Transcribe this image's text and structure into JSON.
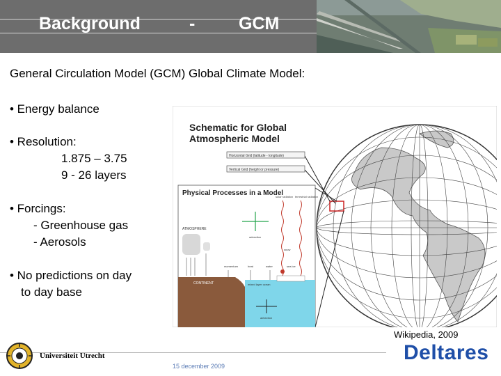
{
  "header": {
    "title_left": "Background",
    "separator": "-",
    "title_right": "GCM"
  },
  "intro": "General Circulation Model   (GCM)   Global Climate Model:",
  "bullets": [
    {
      "label": "• Energy balance"
    },
    {
      "label": "• Resolution:",
      "sub": [
        "1.875 – 3.75",
        "9 - 26 layers"
      ]
    },
    {
      "label": "• Forcings:",
      "sub": [
        "- Greenhouse gas",
        "- Aerosols"
      ]
    },
    {
      "label": "• No predictions on day",
      "cont": "to day base"
    }
  ],
  "figure": {
    "title_line1": "Schematic for Global",
    "title_line2": "Atmospheric Model",
    "label_horizontal": "Horizontal Grid (latitude - longitude)",
    "label_vertical": "Vertical Grid (height or pressure)",
    "inset_title": "Physical Processes in a Model",
    "solar": "solar radiation",
    "terrestrial": "terrestrial radiation",
    "atmosphere": "ATMOSPHERE",
    "advection": "advection",
    "advection_ocean": "advection",
    "momentum": "momentum",
    "heat": "heat",
    "water": "water",
    "snow": "snow",
    "sea_ice": "sea ice",
    "continent": "CONTINENT",
    "mixed_layer": "mixed layer ocean"
  },
  "caption": "Wikipedia, 2009",
  "footer": {
    "university": "Universiteit Utrecht",
    "date": "15 december 2009",
    "brand": "Deltares"
  },
  "colors": {
    "header_bg": "#6d6d6d",
    "brand_blue": "#1f4fa8",
    "date_blue": "#5a7bb5"
  }
}
